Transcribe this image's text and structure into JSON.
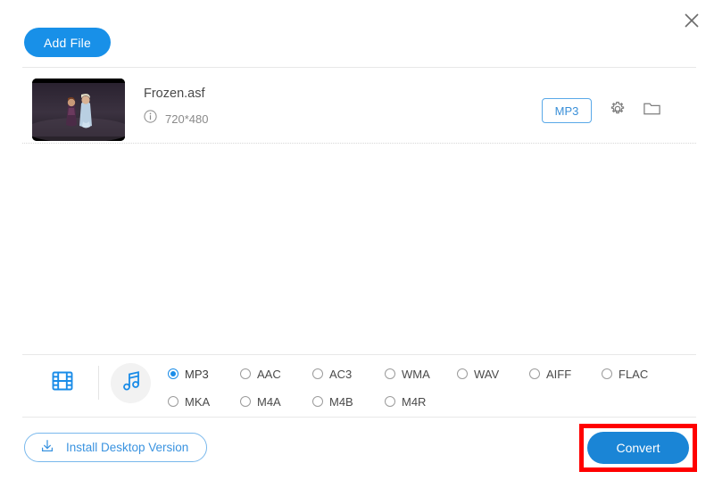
{
  "window": {
    "close_icon": "close-icon"
  },
  "toolbar": {
    "add_file_label": "Add File"
  },
  "file_list": [
    {
      "name": "Frozen.asf",
      "resolution": "720*480",
      "info_icon": "info-icon",
      "format_badge": "MP3",
      "settings_icon": "gear-icon",
      "folder_icon": "folder-icon"
    }
  ],
  "format_bar": {
    "video_tab_icon": "film-strip-icon",
    "audio_tab_icon": "music-note-icon",
    "selected_format": "MP3",
    "rows": [
      [
        {
          "label": "MP3",
          "selected": true
        },
        {
          "label": "AAC",
          "selected": false
        },
        {
          "label": "AC3",
          "selected": false
        },
        {
          "label": "WMA",
          "selected": false
        },
        {
          "label": "WAV",
          "selected": false
        },
        {
          "label": "AIFF",
          "selected": false
        },
        {
          "label": "FLAC",
          "selected": false
        }
      ],
      [
        {
          "label": "MKA",
          "selected": false
        },
        {
          "label": "M4A",
          "selected": false
        },
        {
          "label": "M4B",
          "selected": false
        },
        {
          "label": "M4R",
          "selected": false
        }
      ]
    ]
  },
  "footer": {
    "install_label": "Install Desktop Version",
    "install_icon": "download-icon",
    "convert_label": "Convert"
  },
  "colors": {
    "accent_blue": "#1890e8",
    "convert_blue": "#1a85d6",
    "badge_blue": "#3a8fd8",
    "highlight_red": "#ff0000",
    "text_gray": "#4a4a4a",
    "muted_gray": "#8a8a8a"
  }
}
